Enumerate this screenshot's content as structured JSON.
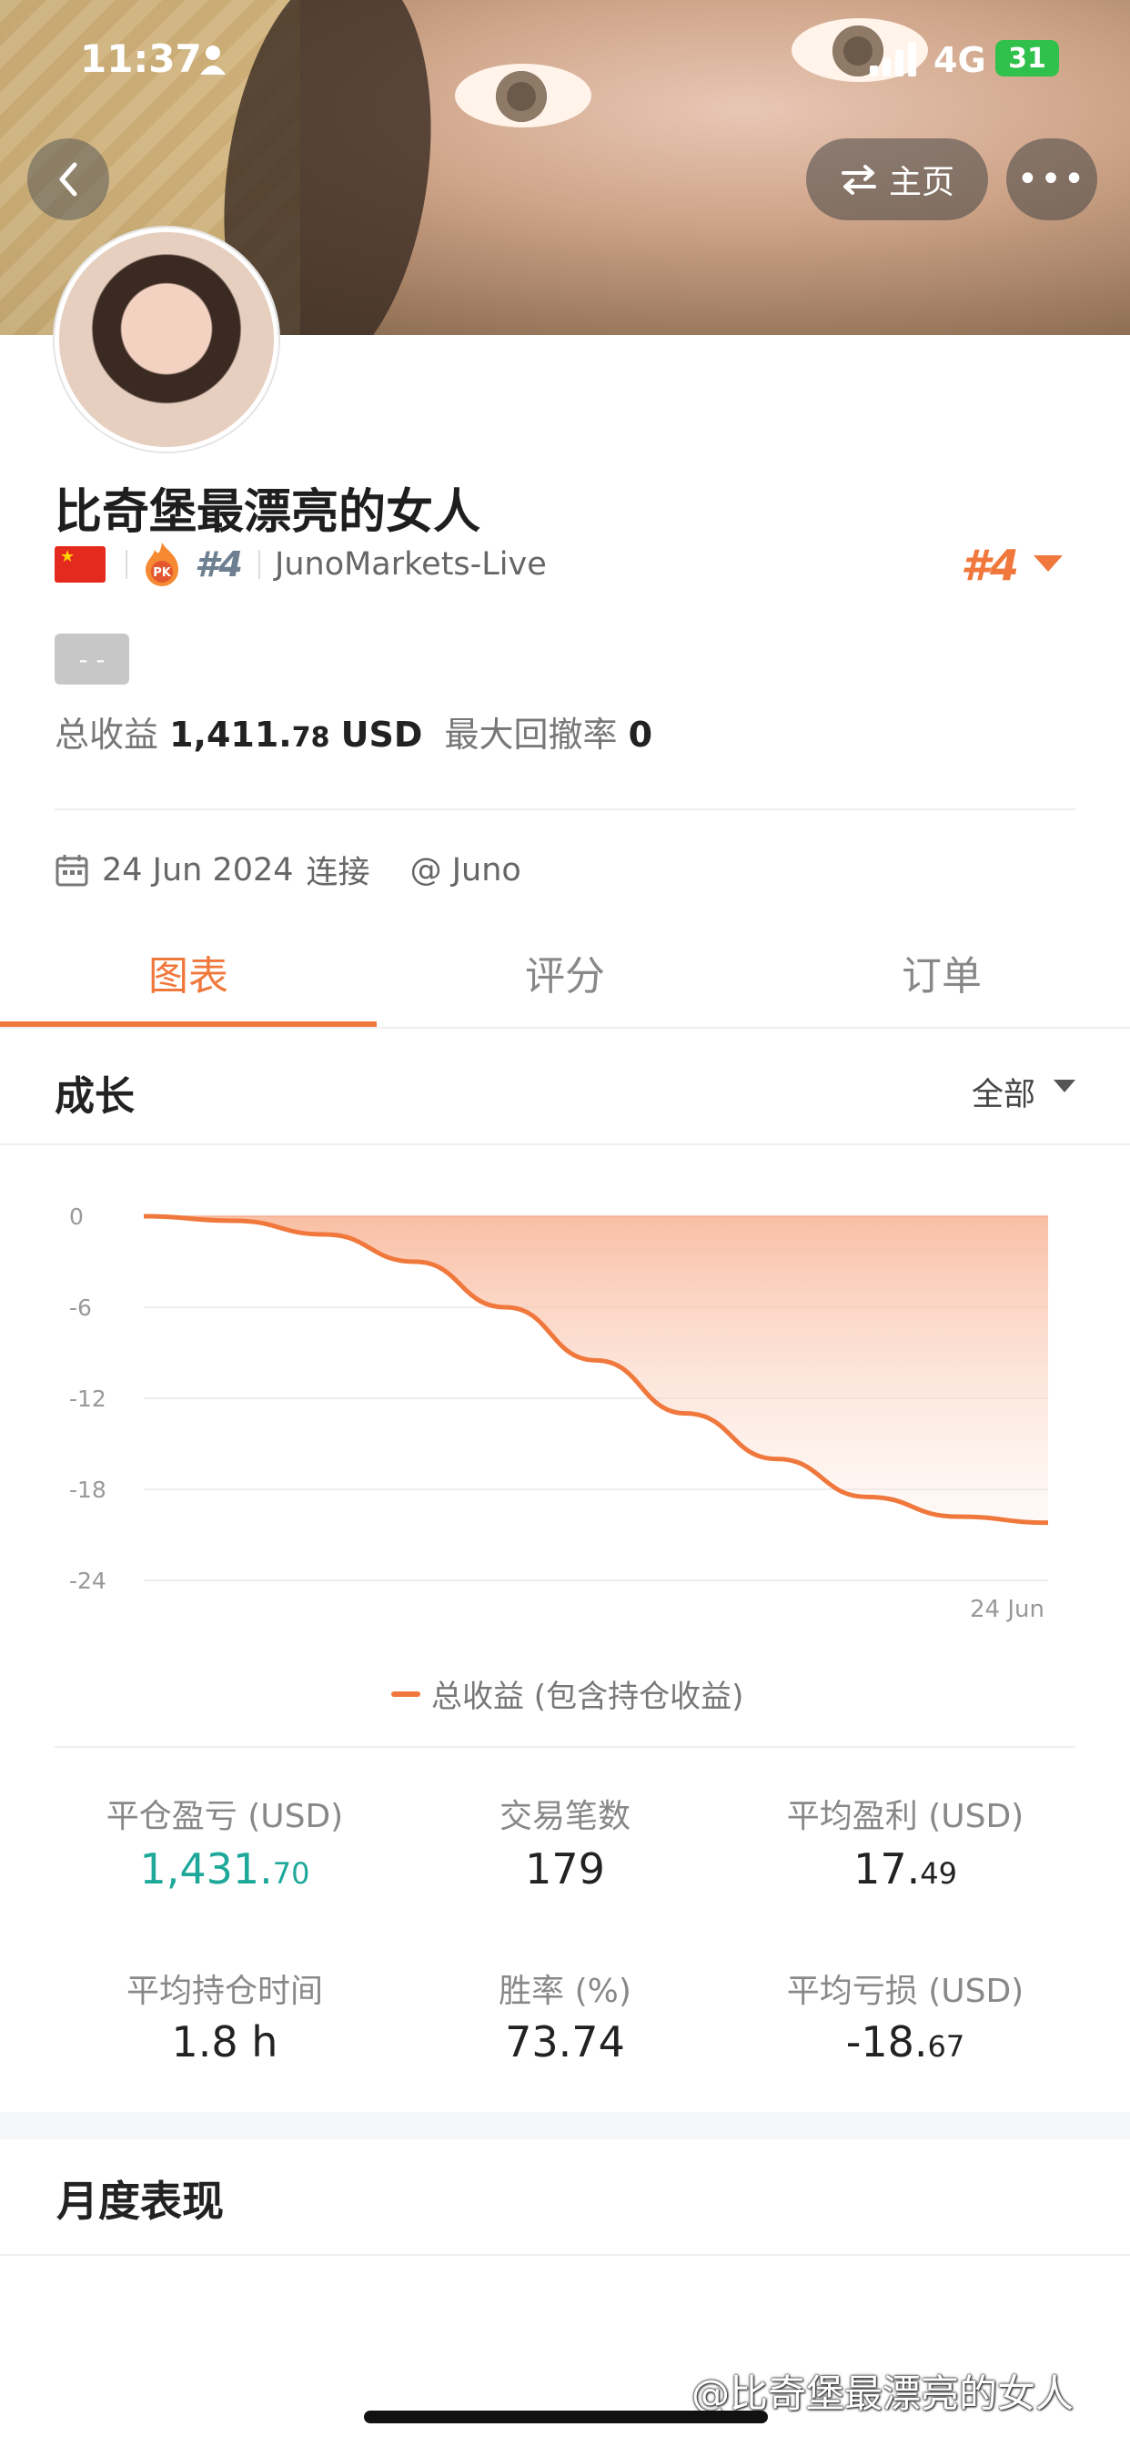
{
  "status_bar": {
    "time": "11:37",
    "network": "4G",
    "battery": "31"
  },
  "header": {
    "home_label": "主页",
    "more_label": "•••"
  },
  "profile": {
    "name": "比奇堡最漂亮的女人",
    "rank_tag": "#4",
    "server": "JunoMarkets-Live",
    "rank_right": "#4",
    "grey_badge": "- -",
    "total_profit_label": "总收益",
    "total_profit_int": "1,411.",
    "total_profit_dec": "78",
    "total_profit_unit": "USD",
    "max_drawdown_label": "最大回撤率",
    "max_drawdown_value": "0",
    "connect_date": "24 Jun 2024",
    "connect_suffix": "连接",
    "broker": "@ Juno"
  },
  "tabs": [
    {
      "label": "图表",
      "active": true
    },
    {
      "label": "评分",
      "active": false
    },
    {
      "label": "订单",
      "active": false
    }
  ],
  "growth": {
    "title": "成长",
    "filter": "全部"
  },
  "chart_data": {
    "type": "area",
    "x": [
      "24 Jun"
    ],
    "series": [
      {
        "name": "总收益 (包含持仓收益)",
        "values": [
          0,
          -0.3,
          -1.2,
          -3,
          -6,
          -9.5,
          -13,
          -16,
          -18.5,
          -19.8,
          -20.2
        ],
        "color": "#f0783c"
      }
    ],
    "y_ticks": [
      "0",
      "-6",
      "-12",
      "-18",
      "-24"
    ],
    "ylim": [
      -24,
      0
    ],
    "x_tick_label": "24 Jun",
    "legend": "总收益 (包含持仓收益)",
    "legend_position": "bottom-center",
    "grid": true
  },
  "stats": [
    {
      "label": "平仓盈亏 (USD)",
      "int": "1,431.",
      "dec": "70",
      "color": "#1ea89a"
    },
    {
      "label": "交易笔数",
      "int": "179",
      "dec": "",
      "color": "#222222"
    },
    {
      "label": "平均盈利 (USD)",
      "int": "17.",
      "dec": "49",
      "color": "#222222"
    },
    {
      "label": "平均持仓时间",
      "int": "1.8 h",
      "dec": "",
      "color": "#222222"
    },
    {
      "label": "胜率 (%)",
      "int": "73.74",
      "dec": "",
      "color": "#222222"
    },
    {
      "label": "平均亏损 (USD)",
      "int": "-18.",
      "dec": "67",
      "color": "#222222"
    }
  ],
  "monthly": {
    "title": "月度表现"
  },
  "watermark": "@比奇堡最漂亮的女人"
}
